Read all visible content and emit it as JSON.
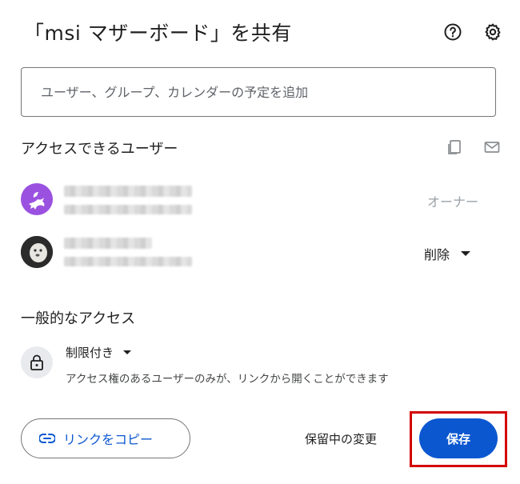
{
  "dialog": {
    "title": "「msi マザーボード」を共有"
  },
  "header_icons": {
    "help": "help-icon",
    "settings": "gear-icon"
  },
  "search": {
    "placeholder": "ユーザー、グループ、カレンダーの予定を追加"
  },
  "people_section": {
    "title": "アクセスできるユーザー",
    "icons": [
      "copy-icon",
      "mail-icon"
    ],
    "users": [
      {
        "role": "オーナー",
        "avatar": "pegasus-avatar"
      },
      {
        "role": "削除",
        "avatar": "photo-avatar"
      }
    ]
  },
  "general_access": {
    "title": "一般的なアクセス",
    "setting": "制限付き",
    "description": "アクセス権のあるユーザーのみが、リンクから開くことができます"
  },
  "footer": {
    "copy_link": "リンクをコピー",
    "pending": "保留中の変更",
    "save": "保存"
  },
  "colors": {
    "accent": "#0b57d0",
    "highlight": "#d40000"
  }
}
